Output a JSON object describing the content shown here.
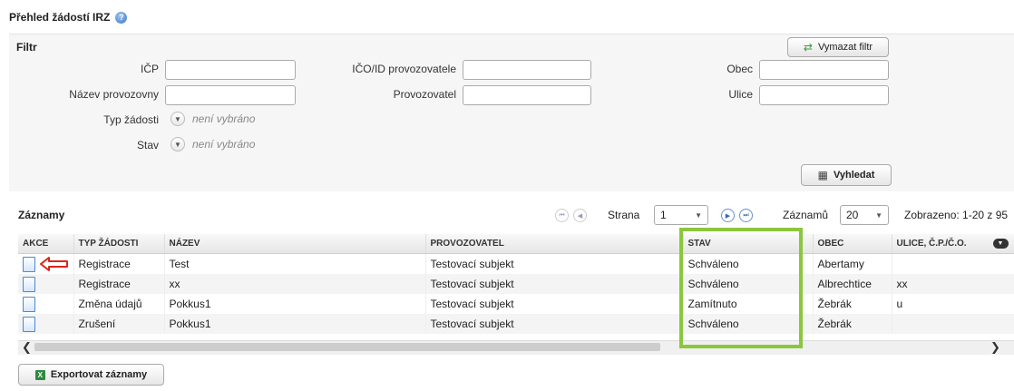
{
  "page": {
    "title": "Přehled žádostí IRZ",
    "help_icon": "?"
  },
  "filter": {
    "heading": "Filtr",
    "clear_button": "Vymazat filtr",
    "labels": {
      "icp": "IČP",
      "ico": "IČO/ID provozovatele",
      "obec": "Obec",
      "nazev": "Název provozovny",
      "provozovatel": "Provozovatel",
      "ulice": "Ulice",
      "typ": "Typ žádosti",
      "stav": "Stav"
    },
    "not_selected": "není vybráno",
    "search_button": "Vyhledat"
  },
  "records": {
    "heading": "Záznamy",
    "page_label": "Strana",
    "page_value": "1",
    "count_label": "Záznamů",
    "count_value": "20",
    "shown": "Zobrazeno: 1-20 z 95",
    "columns": [
      "AKCE",
      "TYP ŽÁDOSTI",
      "NÁZEV",
      "PROVOZOVATEL",
      "STAV",
      "OBEC",
      "ULICE, Č.P./Č.O."
    ],
    "rows": [
      {
        "typ": "Registrace",
        "nazev": "Test",
        "provozovatel": "Testovací subjekt",
        "stav": "Schváleno",
        "obec": "Abertamy",
        "ulice": ""
      },
      {
        "typ": "Registrace",
        "nazev": "xx",
        "provozovatel": "Testovací subjekt",
        "stav": "Schváleno",
        "obec": "Albrechtice",
        "ulice": "xx"
      },
      {
        "typ": "Změna údajů",
        "nazev": "Pokkus1",
        "provozovatel": "Testovací subjekt",
        "stav": "Zamítnuto",
        "obec": "Žebrák",
        "ulice": "u"
      },
      {
        "typ": "Zrušení",
        "nazev": "Pokkus1",
        "provozovatel": "Testovací subjekt",
        "stav": "Schváleno",
        "obec": "Žebrák",
        "ulice": ""
      }
    ],
    "export_button": "Exportovat záznamy"
  },
  "colors": {
    "highlight": "#8cc63f",
    "arrow": "#d9261c",
    "link_blue": "#3466b8"
  }
}
